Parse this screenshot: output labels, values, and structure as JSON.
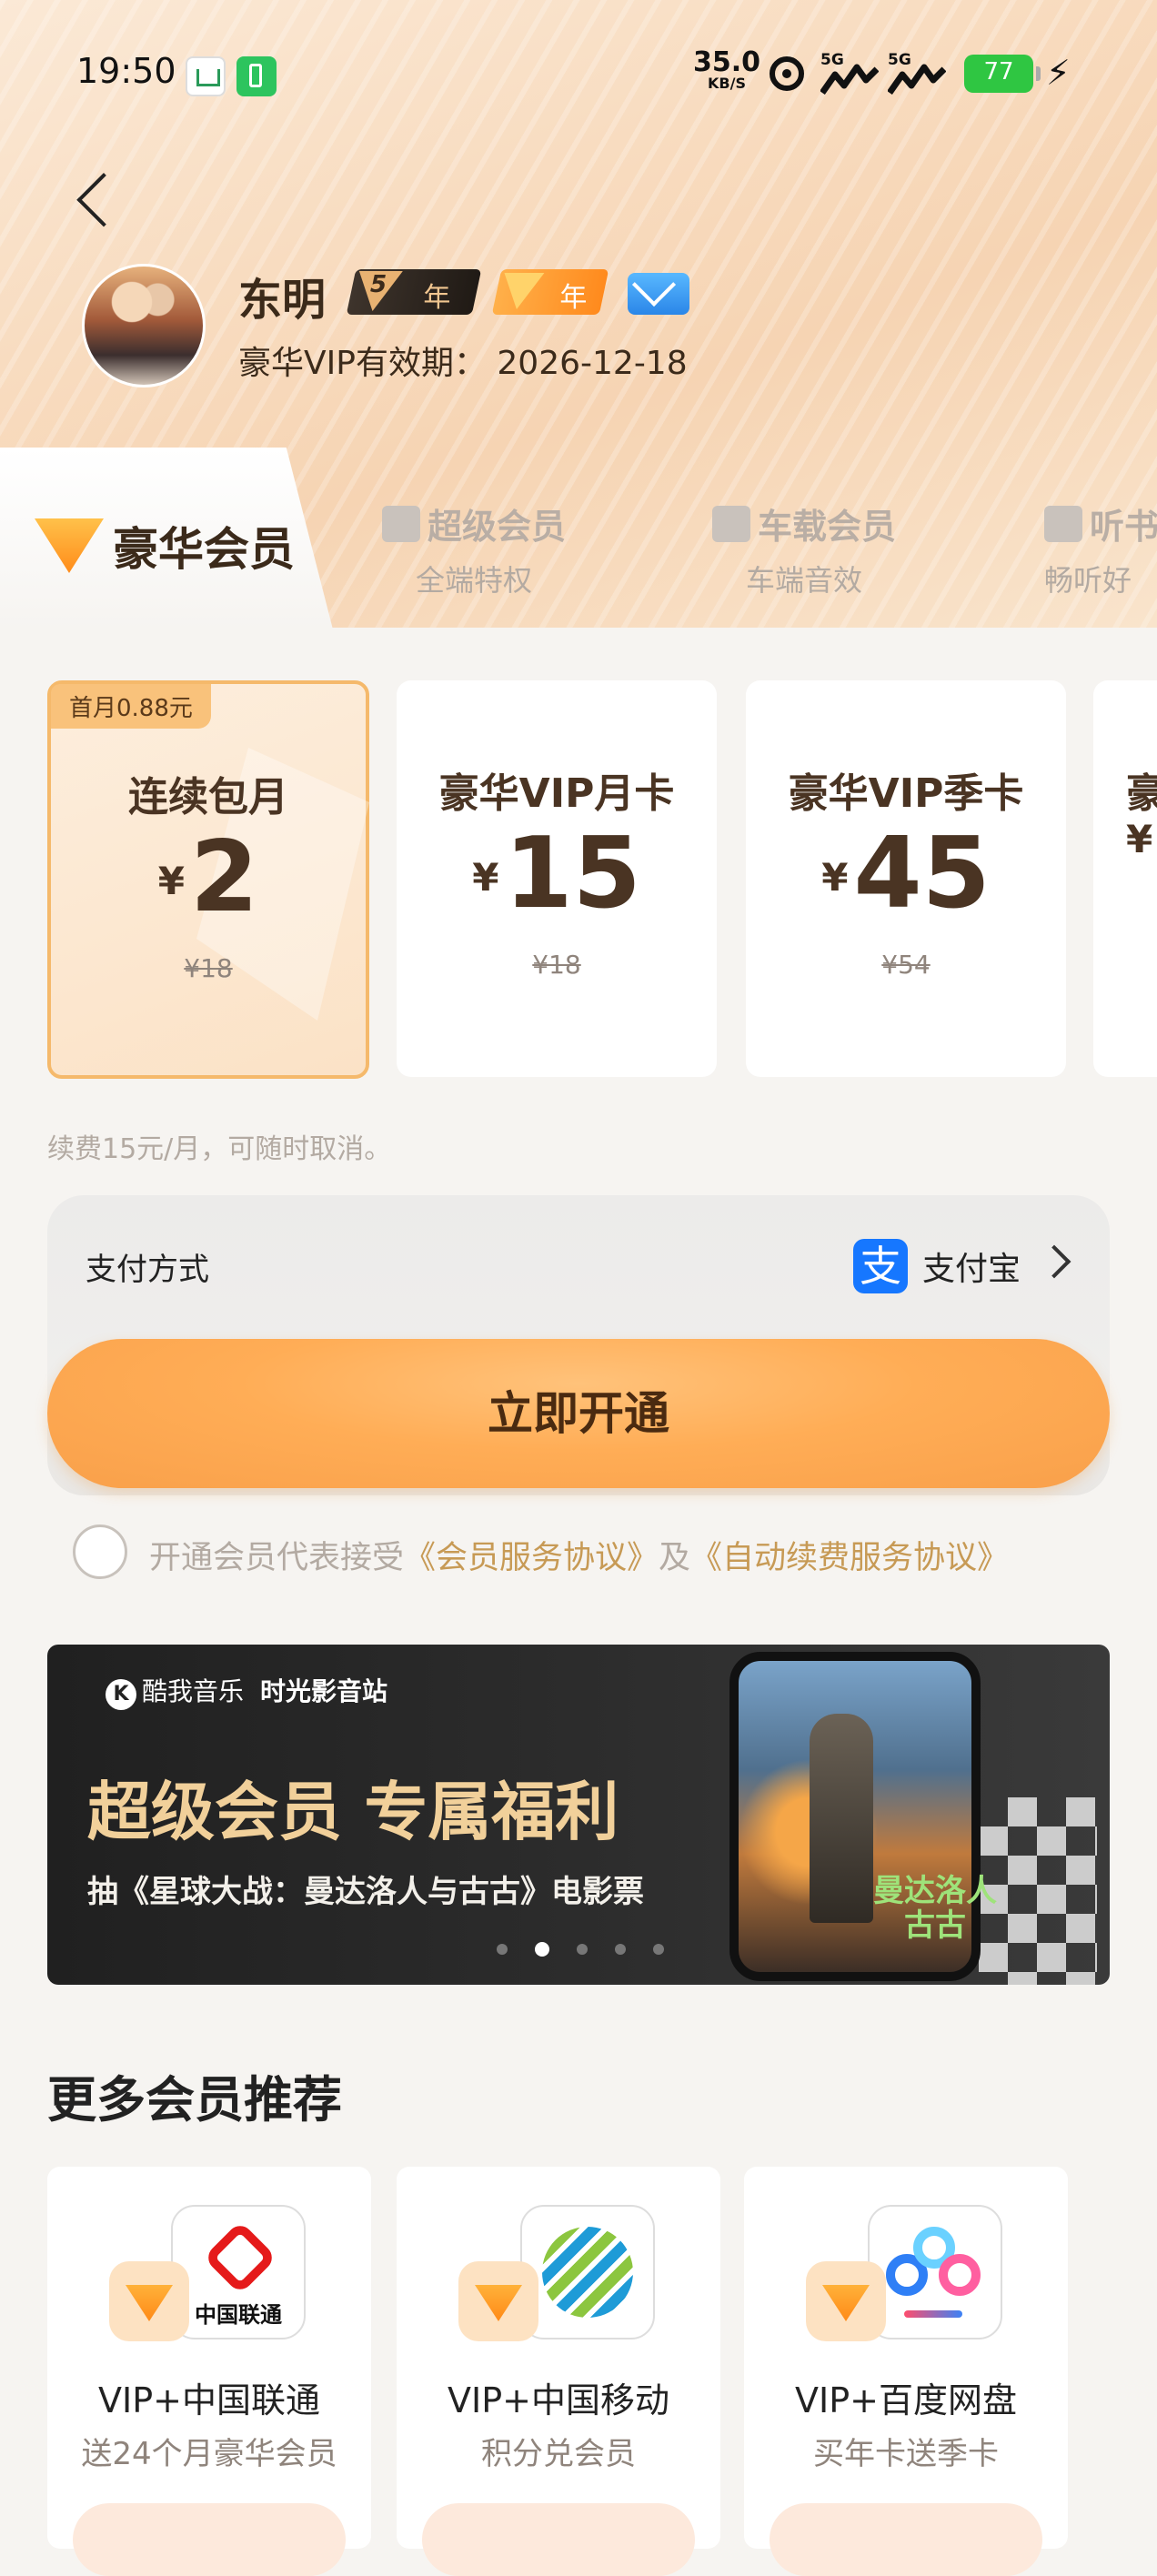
{
  "status_bar": {
    "time": "19:50",
    "net_speed": "35.0",
    "net_unit": "KB/S",
    "signal_1": "5G",
    "signal_2": "5G",
    "battery": "77"
  },
  "profile": {
    "name": "东明",
    "badge_svip_level": "5",
    "badge_svip_year": "年",
    "badge_vip_year": "年",
    "validity": "豪华VIP有效期： 2026-12-18"
  },
  "tabs": [
    {
      "label": "豪华会员",
      "sub": ""
    },
    {
      "label": "超级会员",
      "sub": "全端特权"
    },
    {
      "label": "车载会员",
      "sub": "车端音效"
    },
    {
      "label": "听书",
      "sub": "畅听好"
    }
  ],
  "plans": [
    {
      "promo": "首月0.88元",
      "title": "连续包月",
      "currency": "¥",
      "price": "2",
      "original": "¥18"
    },
    {
      "title": "豪华VIP月卡",
      "currency": "¥",
      "price": "15",
      "original": "¥18"
    },
    {
      "title": "豪华VIP季卡",
      "currency": "¥",
      "price": "45",
      "original": "¥54"
    },
    {
      "title": "豪",
      "currency": "¥",
      "price": "",
      "original": ""
    }
  ],
  "renew_note": "续费15元/月，可随时取消。",
  "payment": {
    "label": "支付方式",
    "method_icon": "支",
    "method": "支付宝"
  },
  "open_button": "立即开通",
  "agreement": {
    "prefix": "开通会员代表接受",
    "link1": "《会员服务协议》",
    "and": "及",
    "link2": "《自动续费服务协议》"
  },
  "banner": {
    "logo_k": "K",
    "logo_brand": "酷我音乐",
    "logo_brand2": "时光影音站",
    "title": "超级会员 专属福利",
    "subtitle": "抽《星球大战：曼达洛人与古古》电影票",
    "poster_title": "曼达洛人\n古古",
    "active_dot": 1,
    "dot_count": 5
  },
  "more": {
    "title": "更多会员推荐",
    "items": [
      {
        "logo_text": "中国联通",
        "name": "VIP+中国联通",
        "desc": "送24个月豪华会员"
      },
      {
        "logo_text": "",
        "name": "VIP+中国移动",
        "desc": "积分兑会员"
      },
      {
        "logo_text": "",
        "name": "VIP+百度网盘",
        "desc": "买年卡送季卡"
      }
    ]
  },
  "colors": {
    "accent": "#ffad56",
    "brand_gold": "#c79a55",
    "text_brown": "#4a3423"
  }
}
